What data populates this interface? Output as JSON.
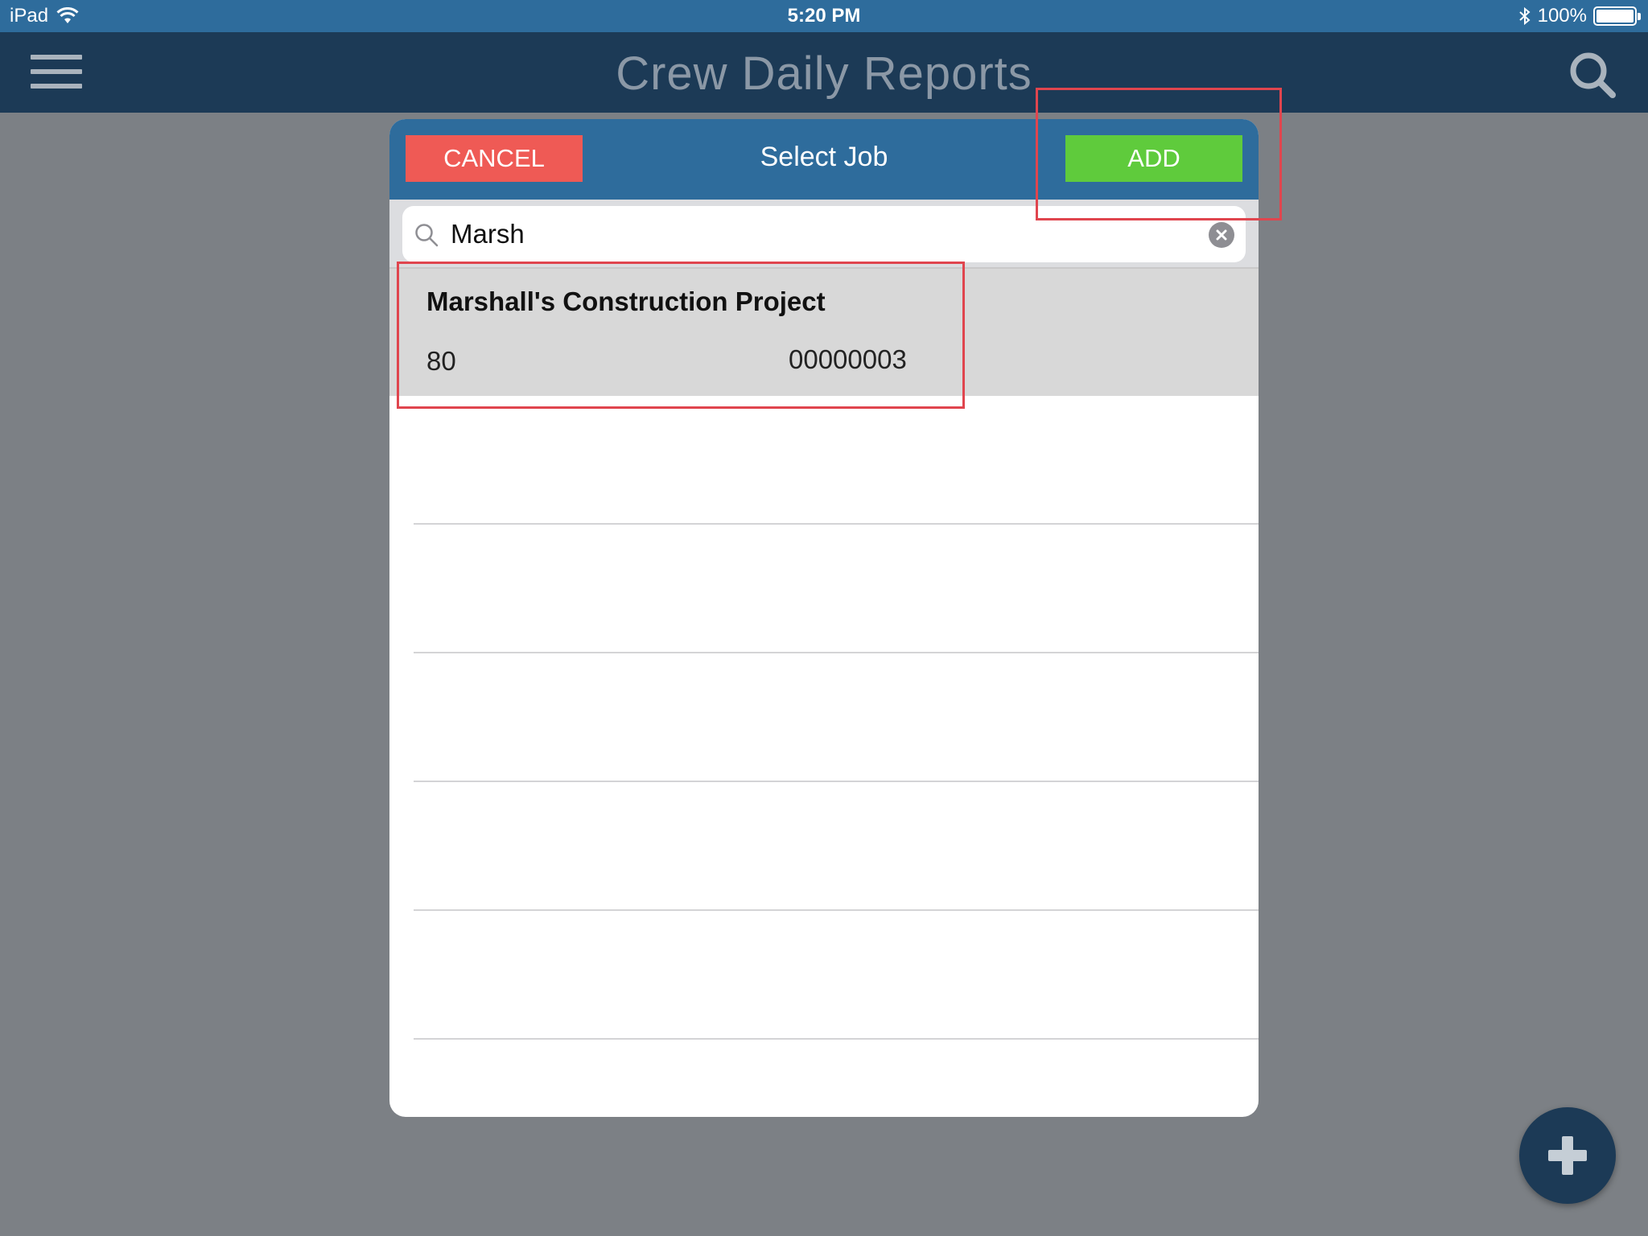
{
  "status_bar": {
    "device": "iPad",
    "time": "5:20 PM",
    "battery": "100%"
  },
  "nav": {
    "title": "Crew Daily Reports",
    "menu_icon": "hamburger-menu-icon",
    "search_icon": "search-icon"
  },
  "modal": {
    "title": "Select Job",
    "cancel_label": "CANCEL",
    "add_label": "ADD",
    "search": {
      "value": "Marsh",
      "placeholder": ""
    },
    "results": [
      {
        "title": "Marshall's Construction Project",
        "number": "80",
        "code": "00000003"
      }
    ]
  },
  "fab": {
    "icon": "plus-icon"
  },
  "colors": {
    "status_bar": "#2e6c9c",
    "nav_bar": "#1c3a56",
    "cancel": "#ef5a55",
    "add": "#5fcb3c",
    "highlight": "#e0454e"
  }
}
